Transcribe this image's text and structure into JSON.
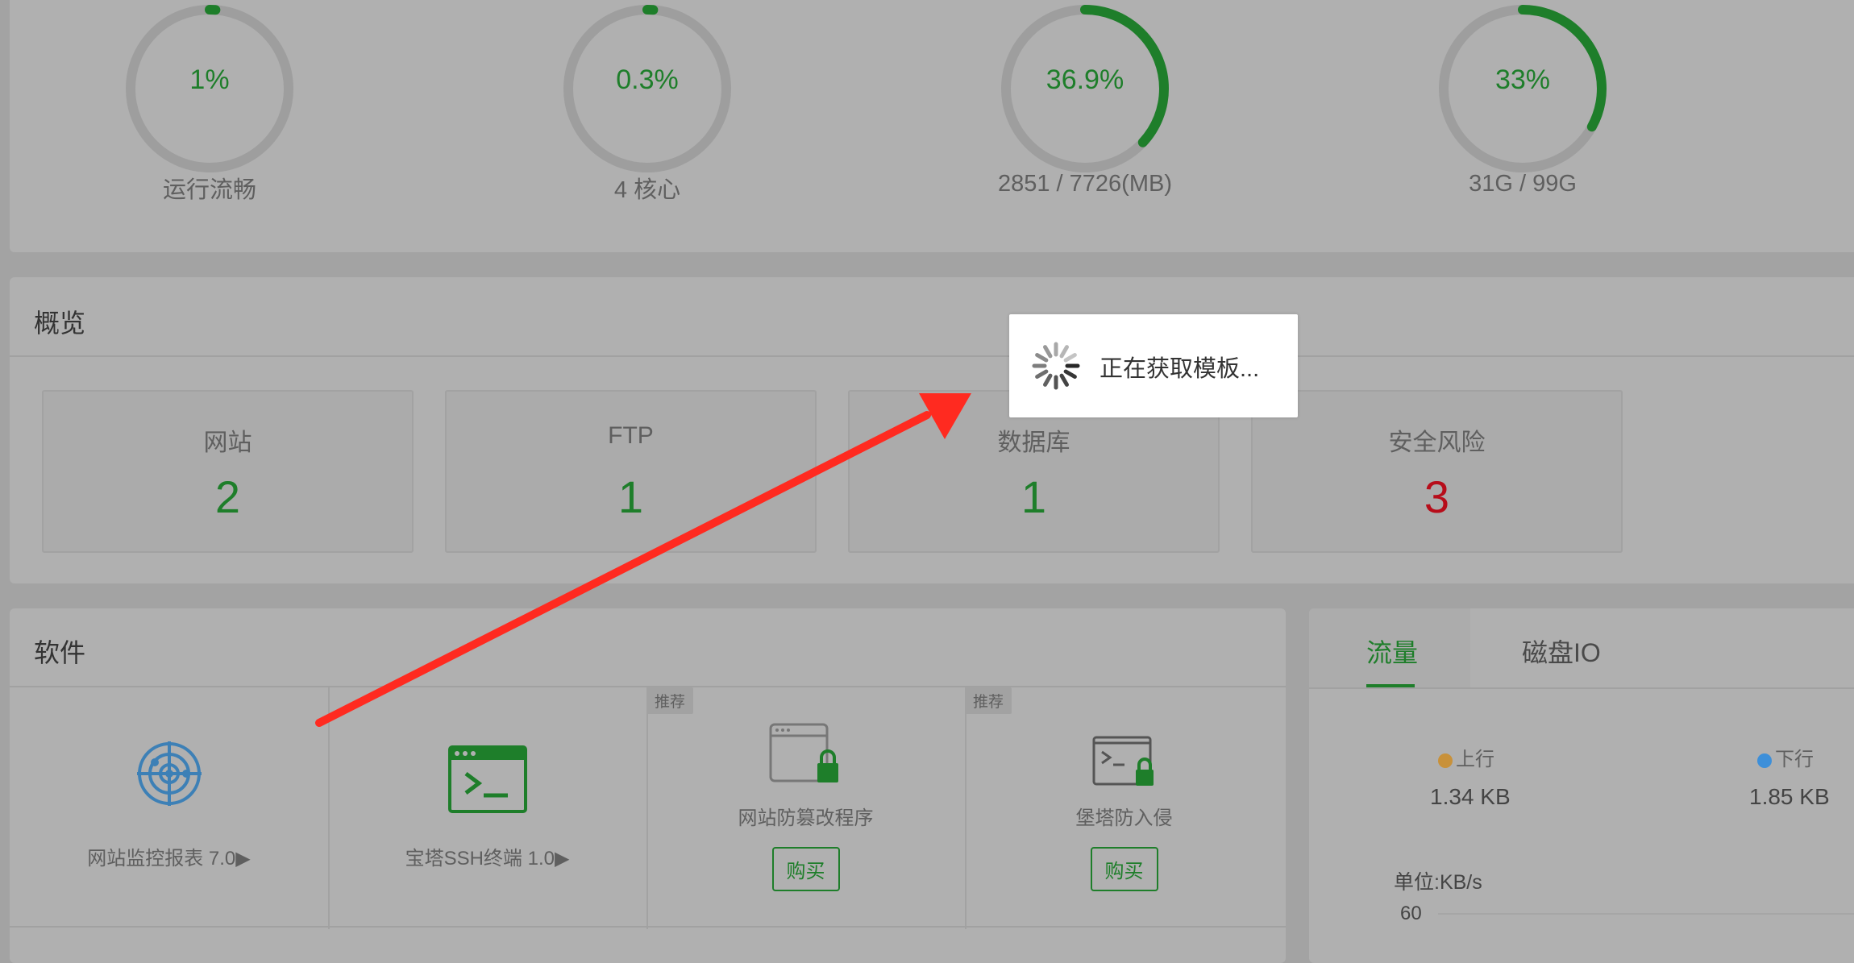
{
  "colors": {
    "accent": "#1e7e2a",
    "danger": "#b70d1a",
    "arrow": "#ff2a20",
    "upload_dot": "#c8913a",
    "download_dot": "#3d8fd9"
  },
  "status": {
    "gauges": [
      {
        "percent": "1%",
        "caption": "运行流畅",
        "value": 0.01
      },
      {
        "percent": "0.3%",
        "caption": "4 核心",
        "value": 0.003
      },
      {
        "percent": "36.9%",
        "caption": "2851 / 7726(MB)",
        "value": 0.369
      },
      {
        "percent": "33%",
        "caption": "31G / 99G",
        "value": 0.33
      }
    ]
  },
  "overview": {
    "title": "概览",
    "cards": [
      {
        "label": "网站",
        "value": "2"
      },
      {
        "label": "FTP",
        "value": "1"
      },
      {
        "label": "数据库",
        "value": "1"
      },
      {
        "label": "安全风险",
        "value": "3"
      }
    ]
  },
  "loading": {
    "text": "正在获取模板..."
  },
  "software": {
    "title": "软件",
    "items": [
      {
        "name": "网站监控报表 7.0▶",
        "icon": "radar-icon"
      },
      {
        "name": "宝塔SSH终端 1.0▶",
        "icon": "terminal-icon"
      },
      {
        "name": "网站防篡改程序",
        "icon": "browser-lock-icon",
        "tag": "推荐",
        "buy": "购买"
      },
      {
        "name": "堡塔防入侵",
        "icon": "terminal-lock-icon",
        "tag": "推荐",
        "buy": "购买"
      }
    ]
  },
  "traffic": {
    "tabs": [
      {
        "label": "流量"
      },
      {
        "label": "磁盘IO"
      }
    ],
    "upload_label": "上行",
    "upload_value": "1.34 KB",
    "download_label": "下行",
    "download_value": "1.85 KB",
    "unit": "单位:KB/s",
    "ytick": "60"
  }
}
